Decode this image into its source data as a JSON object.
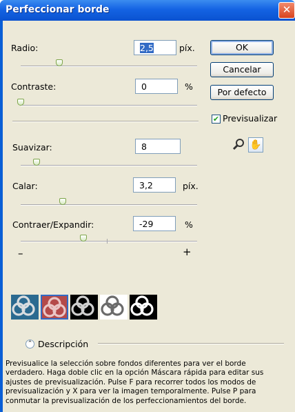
{
  "title": "Perfeccionar borde",
  "close_glyph": "✕",
  "controls": {
    "radio": {
      "label": "Radio:",
      "value": "2,5",
      "unit": "píx.",
      "slider": 0.22
    },
    "contraste": {
      "label": "Contraste:",
      "value": "0",
      "unit": "%",
      "slider": 0.0
    },
    "suavizar": {
      "label": "Suavizar:",
      "value": "8",
      "unit": "",
      "slider": 0.09
    },
    "calar": {
      "label": "Calar:",
      "value": "3,2",
      "unit": "píx.",
      "slider": 0.24
    },
    "contraer": {
      "label": "Contraer/Expandir:",
      "value": "-29",
      "unit": "%",
      "slider": 0.355,
      "minus": "–",
      "plus": "+"
    }
  },
  "buttons": {
    "ok": "OK",
    "cancel": "Cancelar",
    "default": "Por defecto"
  },
  "preview": {
    "label": "Previsualizar",
    "checked": true
  },
  "tools": [
    "zoom-icon",
    "hand-icon"
  ],
  "swatches": [
    {
      "name": "standard",
      "bg": "#2b6a90",
      "knot": "#d9dde0",
      "selected": false
    },
    {
      "name": "quick-mask",
      "bg": "#b44a4a",
      "knot": "#eac6c6",
      "selected": true
    },
    {
      "name": "on-black",
      "bg": "#000000",
      "knot": "#cfcfcf",
      "selected": false
    },
    {
      "name": "on-white",
      "bg": "#ffffff",
      "knot": "#6b6b6b",
      "selected": false
    },
    {
      "name": "mask",
      "bg": "#000000",
      "knot": "#ffffff",
      "selected": false
    }
  ],
  "description": {
    "label": "Descripción",
    "text": "Previsualice la selección sobre fondos diferentes para ver el borde verdadero. Haga doble clic en la opción Máscara rápida para editar sus ajustes de previsualización. Pulse F para recorrer todos los modos de previsualización y X para ver la imagen temporalmente. Pulse P para conmutar la previsualización de los perfeccionamientos del borde."
  },
  "colors": {
    "accent": "#316ac5",
    "titlebar": "#0a52d0",
    "dialog": "#ece9d8"
  }
}
